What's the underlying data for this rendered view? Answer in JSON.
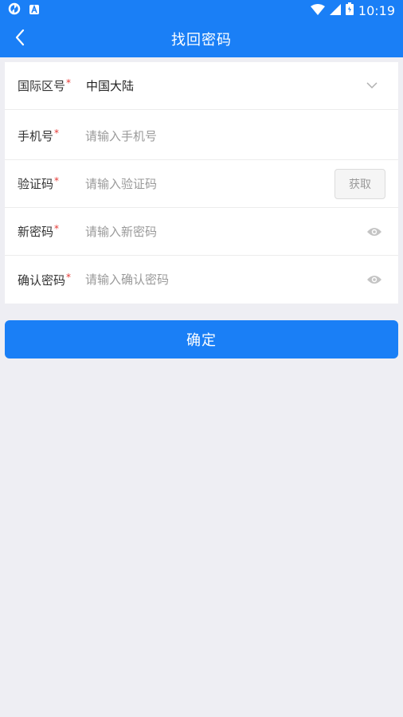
{
  "status_bar": {
    "time": "10:19",
    "left_icons": [
      "sync-icon",
      "notification-a-icon"
    ],
    "right_icons": [
      "wifi-icon",
      "signal-icon",
      "battery-icon"
    ]
  },
  "nav": {
    "title": "找回密码",
    "back_icon": "chevron-left-icon"
  },
  "form": {
    "region": {
      "label": "国际区号",
      "required": "*",
      "value": "中国大陆"
    },
    "phone": {
      "label": "手机号",
      "required": "*",
      "placeholder": "请输入手机号",
      "value": ""
    },
    "code": {
      "label": "验证码",
      "required": "*",
      "placeholder": "请输入验证码",
      "value": "",
      "button_label": "获取"
    },
    "new_password": {
      "label": "新密码",
      "required": "*",
      "placeholder": "请输入新密码",
      "value": ""
    },
    "confirm_password": {
      "label": "确认密码",
      "required": "*",
      "placeholder": "请输入确认密码",
      "value": ""
    }
  },
  "submit_label": "确定",
  "colors": {
    "primary": "#1a7ff6",
    "background": "#eeeef3",
    "required": "#e53935"
  }
}
